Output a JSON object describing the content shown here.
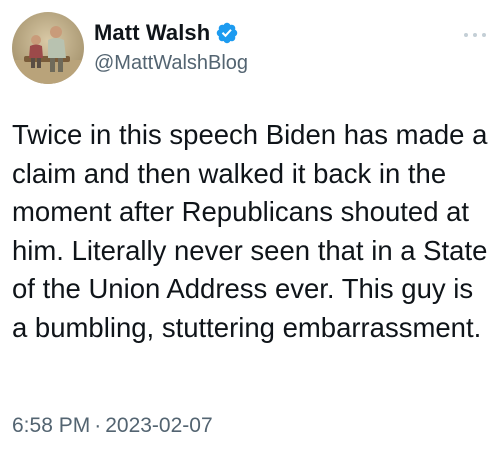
{
  "author": {
    "display_name": "Matt Walsh",
    "handle": "@MattWalshBlog",
    "verified": true,
    "avatar_icon": "profile-photo"
  },
  "tweet": {
    "text": "Twice in this speech Biden has made a claim and then walked it back in the moment after Republicans shouted at him. Literally never seen that in a State of the Union Address ever. This guy is a bumbling, stuttering embarrassment.",
    "time": "6:58 PM",
    "separator": "·",
    "date": "2023-02-07"
  },
  "icons": {
    "verified": "verified-badge-icon",
    "more": "more-options-icon"
  },
  "colors": {
    "text": "#0f1419",
    "secondary": "#536471",
    "verified_blue": "#1d9bf0",
    "more_dots": "#c4cfd6"
  }
}
